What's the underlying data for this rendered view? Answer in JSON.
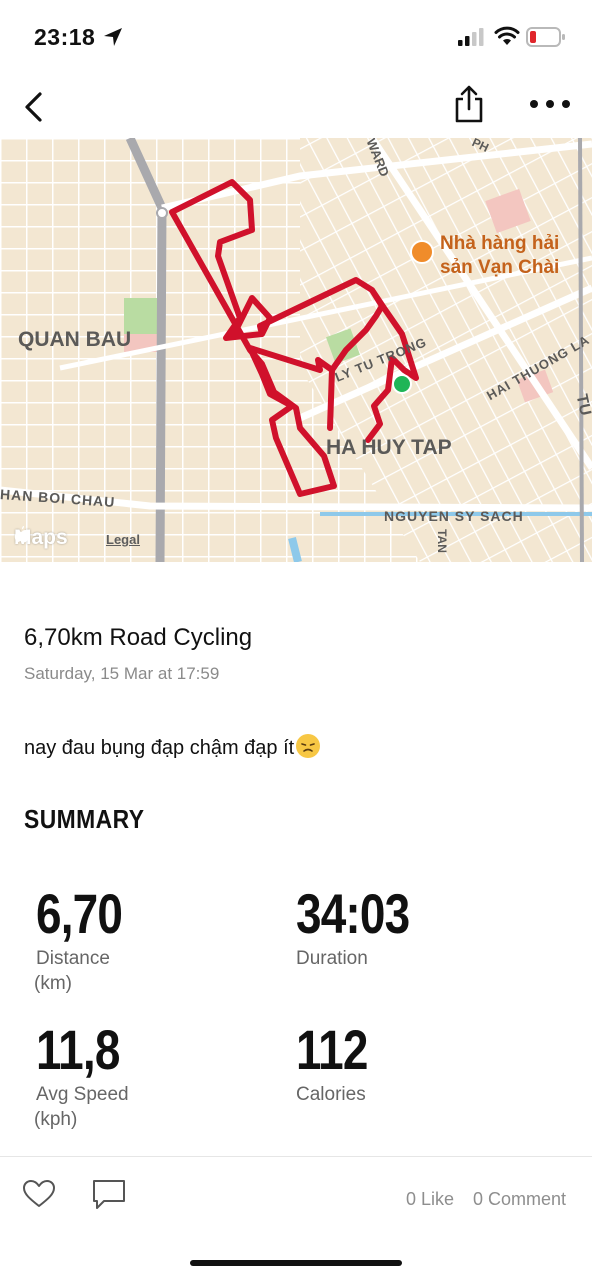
{
  "status_bar": {
    "time": "23:18",
    "icons": [
      "location-arrow-icon",
      "cellular-signal-icon",
      "wifi-icon",
      "battery-low-icon"
    ]
  },
  "nav": {
    "icons": [
      "chevron-left-icon",
      "share-icon",
      "more-dots-icon"
    ]
  },
  "map": {
    "labels": {
      "quan_bau": "QUAN BAU",
      "ha_huy_tap": "HA HUY TAP",
      "nguyen_sy_sach": "NGUYEN SY SACH",
      "han_boi_chau": "HAN BOI CHAU",
      "ly_tu_trong": "LY TU TRONG",
      "hai_thuong": "HAI THUONG LA",
      "ward": "WARD",
      "ph": "PH",
      "tan": "TAN",
      "tu": "TU"
    },
    "poi": {
      "line1": "Nhà hàng hải",
      "line2": "sản Vạn Chài",
      "icon": "restaurant-icon"
    },
    "maps_logo": "Maps",
    "legal": "Legal",
    "colors": {
      "route": "#d0112b",
      "start": "#1fb557",
      "land": "#f3e7d2",
      "road": "#ffffff",
      "major_road": "#a9a9ad",
      "park": "#b9dca2",
      "water": "#8ec9ea"
    }
  },
  "activity": {
    "title": "6,70km Road Cycling",
    "datetime": "Saturday, 15 Mar at 17:59",
    "note": "nay đau bụng đạp chậm đạp ít",
    "note_emoji": "sad-face-emoji"
  },
  "summary": {
    "heading": "SUMMARY",
    "stats": [
      {
        "value": "6,70",
        "label": "Distance",
        "unit": "(km)"
      },
      {
        "value": "34:03",
        "label": "Duration",
        "unit": ""
      },
      {
        "value": "11,8",
        "label": "Avg Speed",
        "unit": "(kph)"
      },
      {
        "value": "112",
        "label": "Calories",
        "unit": ""
      }
    ]
  },
  "footer": {
    "likes": "0 Like",
    "comments": "0 Comment",
    "icons": [
      "heart-icon",
      "comment-icon"
    ]
  }
}
